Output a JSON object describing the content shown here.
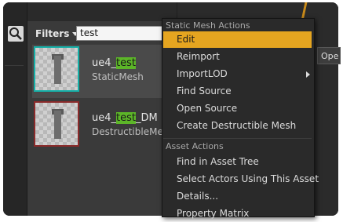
{
  "toolbar": {
    "filters_label": "Filters",
    "search_value": "test"
  },
  "assets": [
    {
      "name_pre": "ue4_",
      "name_hl": "test",
      "name_post": "",
      "type": "StaticMesh"
    },
    {
      "name_pre": "ue4_",
      "name_hl": "test",
      "name_post": "_DM",
      "type": "DestructibleMesh"
    }
  ],
  "background": {
    "open_label": "Ope"
  },
  "menu": {
    "section1": "Static Mesh Actions",
    "section1_items": [
      "Edit",
      "Reimport",
      "ImportLOD",
      "Find Source",
      "Open Source",
      "Create Destructible Mesh"
    ],
    "section2": "Asset Actions",
    "section2_items": [
      "Find in Asset Tree",
      "Select Actors Using This Asset",
      "Details...",
      "Property Matrix"
    ]
  },
  "colors": {
    "highlight": "#5cb528",
    "menu_active": "#e5a520"
  }
}
